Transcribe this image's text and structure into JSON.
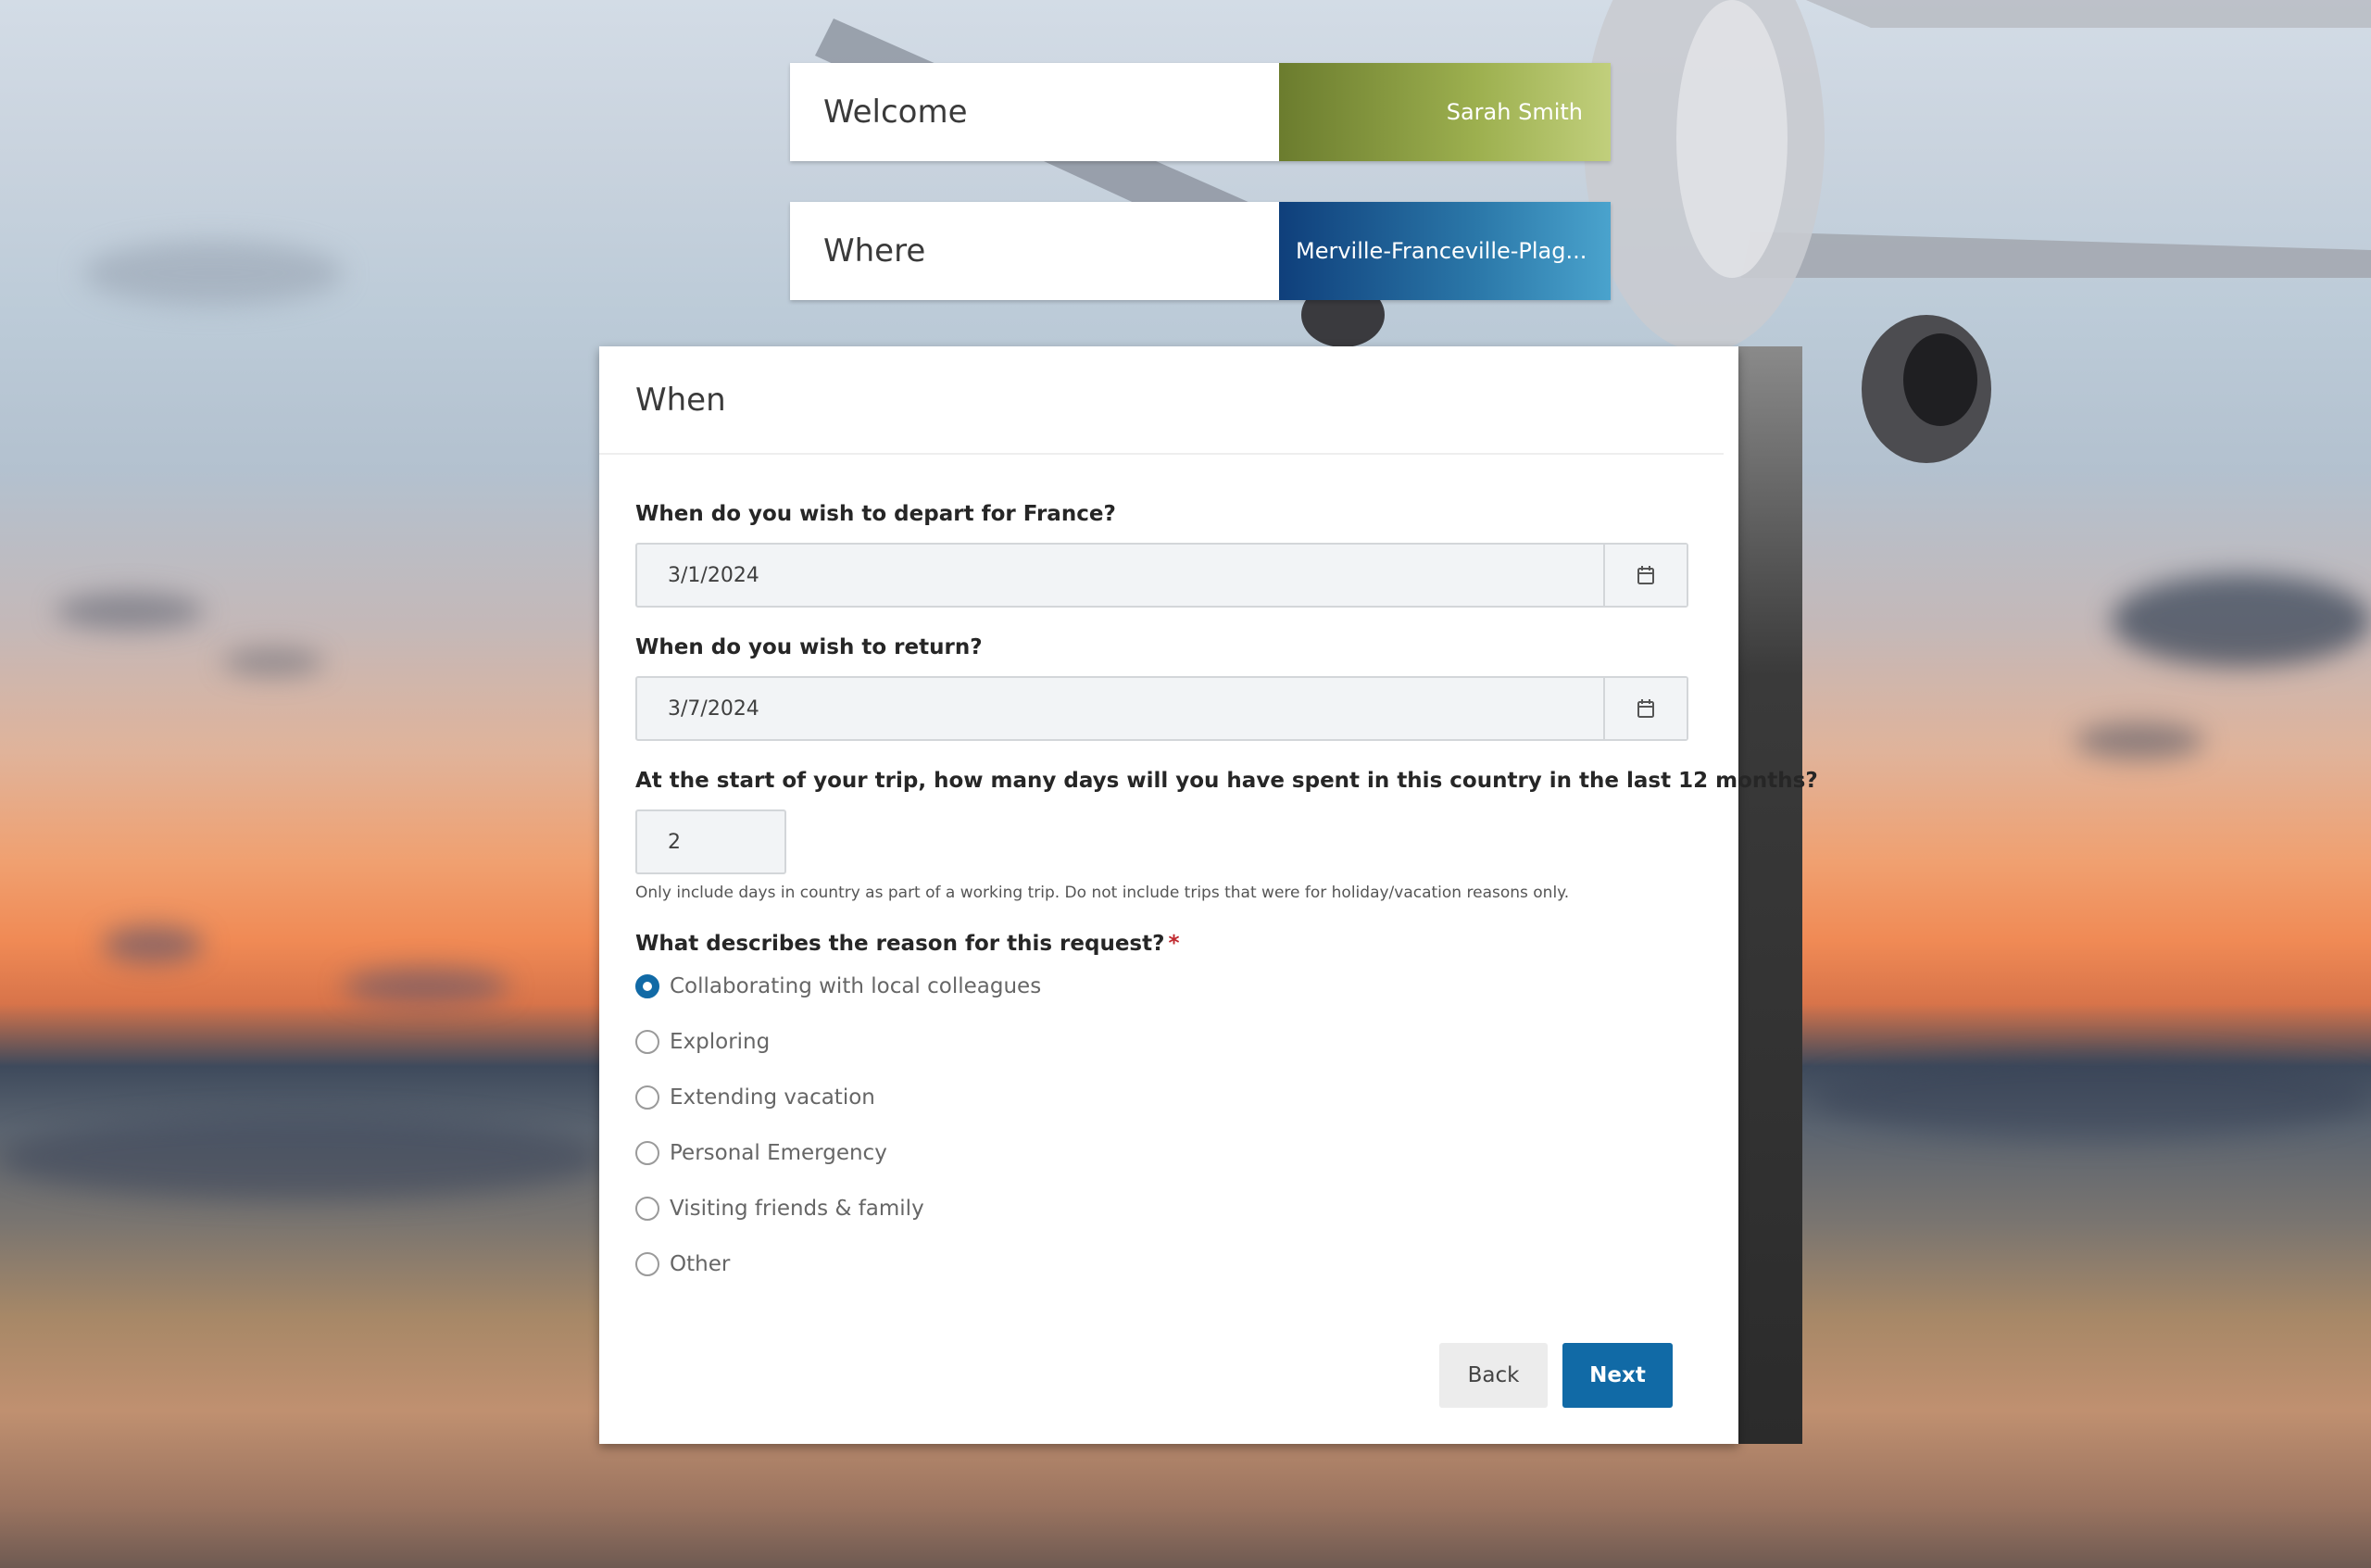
{
  "header": {
    "welcome_label": "Welcome",
    "user_name": "Sarah Smith",
    "where_label": "Where",
    "destination": "Merville-Franceville-Plag..."
  },
  "card": {
    "title": "When",
    "depart_question": "When do you wish to depart for France?",
    "depart_date": "3/1/2024",
    "return_question": "When do you wish to return?",
    "return_date": "3/7/2024",
    "days_question": "At the start of your trip, how many days will you have spent in this country in the last 12 months?",
    "days_value": "2",
    "days_help": "Only include days in country as part of a working trip. Do not include trips that were for holiday/vacation reasons only.",
    "reason_question": "What describes the reason for this request?",
    "required_marker": "*",
    "reasons": [
      {
        "label": "Collaborating with local colleagues",
        "selected": true
      },
      {
        "label": "Exploring",
        "selected": false
      },
      {
        "label": "Extending vacation",
        "selected": false
      },
      {
        "label": "Personal Emergency",
        "selected": false
      },
      {
        "label": "Visiting friends & family",
        "selected": false
      },
      {
        "label": "Other",
        "selected": false
      }
    ],
    "back_label": "Back",
    "next_label": "Next"
  },
  "icons": {
    "calendar": "calendar-icon"
  },
  "colors": {
    "primary": "#116aa6",
    "welcome_accent": "#8fa045",
    "where_accent": "#1c5a94",
    "required": "#c0282e"
  }
}
